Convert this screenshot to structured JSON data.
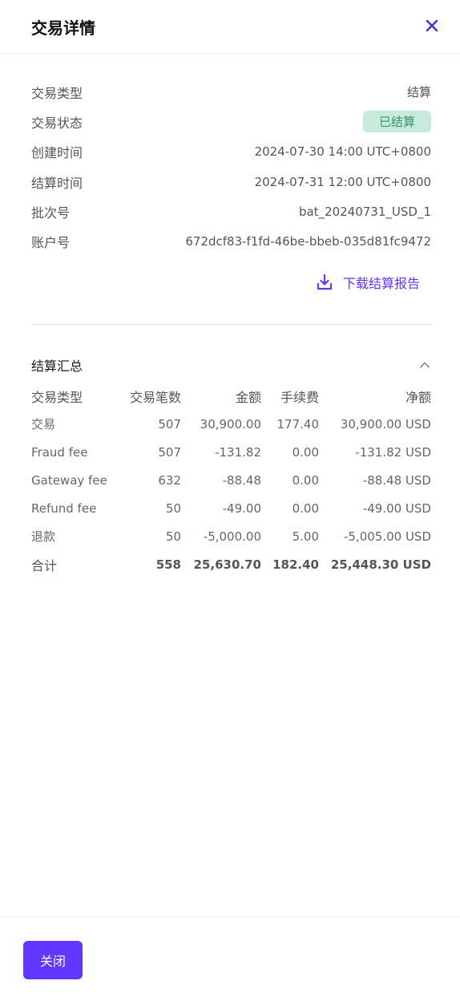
{
  "header": {
    "title": "交易详情",
    "close_icon": "close-icon"
  },
  "details": [
    {
      "label": "交易类型",
      "value": "结算"
    },
    {
      "label": "交易状态",
      "value": "已结算",
      "badge": true
    },
    {
      "label": "创建时间",
      "value": "2024-07-30 14:00 UTC+0800"
    },
    {
      "label": "结算时间",
      "value": "2024-07-31 12:00 UTC+0800"
    },
    {
      "label": "批次号",
      "value": "bat_20240731_USD_1"
    },
    {
      "label": "账户号",
      "value": "672dcf83-f1fd-46be-bbeb-035d81fc9472"
    }
  ],
  "download": {
    "label": "下载结算报告",
    "icon": "download-icon"
  },
  "summary": {
    "title": "结算汇总",
    "collapse_icon": "chevron-up-icon",
    "columns": [
      "交易类型",
      "交易笔数",
      "金额",
      "手续费",
      "净额"
    ],
    "rows": [
      [
        "交易",
        "507",
        "30,900.00",
        "177.40",
        "30,900.00 USD"
      ],
      [
        "Fraud fee",
        "507",
        "-131.82",
        "0.00",
        "-131.82 USD"
      ],
      [
        "Gateway fee",
        "632",
        "-88.48",
        "0.00",
        "-88.48 USD"
      ],
      [
        "Refund fee",
        "50",
        "-49.00",
        "0.00",
        "-49.00 USD"
      ],
      [
        "退款",
        "50",
        "-5,000.00",
        "5.00",
        "-5,005.00 USD"
      ]
    ],
    "total": [
      "合计",
      "558",
      "25,630.70",
      "182.40",
      "25,448.30 USD"
    ]
  },
  "footer": {
    "close_label": "关闭"
  },
  "colors": {
    "accent": "#6236ff",
    "badge_bg": "#c6eadb",
    "badge_text": "#3f8f6c"
  }
}
